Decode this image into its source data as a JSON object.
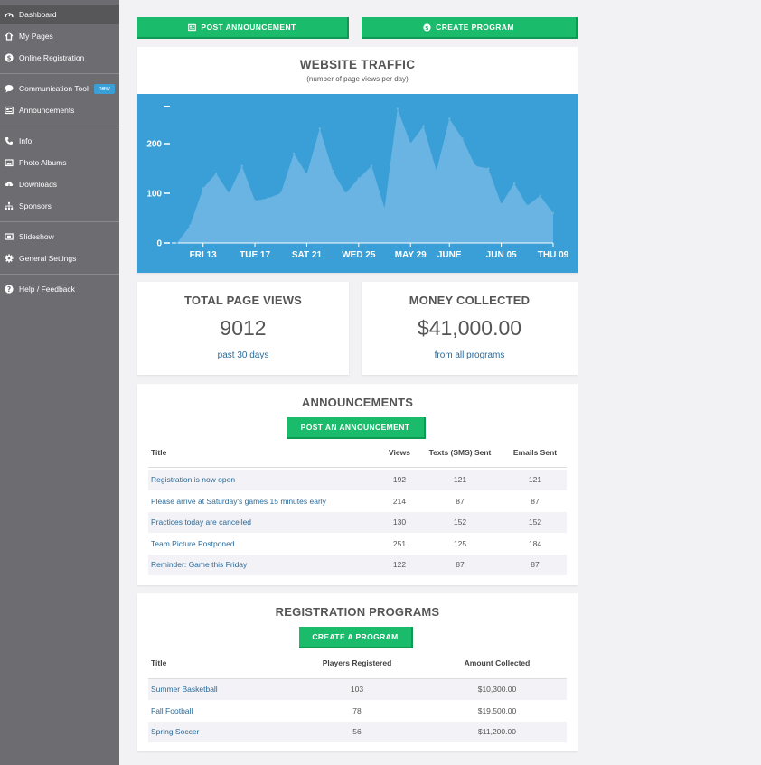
{
  "sidebar": {
    "items": [
      {
        "label": "Dashboard",
        "icon": "gauge-icon"
      },
      {
        "label": "My Pages",
        "icon": "home-icon"
      },
      {
        "label": "Online Registration",
        "icon": "dollar-icon"
      },
      {
        "label": "Communication Tool",
        "icon": "chat-icon",
        "badge": "new"
      },
      {
        "label": "Announcements",
        "icon": "newspaper-icon"
      },
      {
        "label": "Info",
        "icon": "phone-icon"
      },
      {
        "label": "Photo Albums",
        "icon": "photo-icon"
      },
      {
        "label": "Downloads",
        "icon": "cloud-download-icon"
      },
      {
        "label": "Sponsors",
        "icon": "sitemap-icon"
      },
      {
        "label": "Slideshow",
        "icon": "slideshow-icon"
      },
      {
        "label": "General Settings",
        "icon": "gear-icon"
      },
      {
        "label": "Help / Feedback",
        "icon": "question-icon"
      }
    ]
  },
  "top_buttons": {
    "post_announcement": "POST ANNOUNCEMENT",
    "create_program": "CREATE PROGRAM"
  },
  "traffic": {
    "title": "WEBSITE TRAFFIC",
    "subtitle": "(number of page views per day)"
  },
  "chart_data": {
    "type": "area",
    "title": "WEBSITE TRAFFIC",
    "subtitle": "(number of page views per day)",
    "ylim": [
      0,
      300
    ],
    "yticks": [
      {
        "v": 0,
        "label": "0"
      },
      {
        "v": 100,
        "label": "100"
      },
      {
        "v": 200,
        "label": "200"
      },
      {
        "v": 275,
        "label": ""
      }
    ],
    "xticks": [
      {
        "i": 2,
        "label": "FRI 13"
      },
      {
        "i": 6,
        "label": "TUE 17"
      },
      {
        "i": 10,
        "label": "SAT 21"
      },
      {
        "i": 14,
        "label": "WED 25"
      },
      {
        "i": 18,
        "label": "MAY 29"
      },
      {
        "i": 21,
        "label": "JUNE"
      },
      {
        "i": 25,
        "label": "JUN 05"
      },
      {
        "i": 29,
        "label": "THU 09"
      }
    ],
    "values": [
      0,
      35,
      110,
      140,
      100,
      155,
      85,
      90,
      100,
      180,
      138,
      230,
      145,
      100,
      130,
      155,
      70,
      270,
      200,
      235,
      145,
      250,
      210,
      155,
      150,
      78,
      120,
      75,
      95,
      60
    ],
    "fill_color": "#6ab4e3",
    "bg_color": "#3a9fd6",
    "grid": false
  },
  "stats": {
    "page_views": {
      "title": "TOTAL PAGE VIEWS",
      "value": "9012",
      "sub": "past 30 days"
    },
    "money": {
      "title": "MONEY COLLECTED",
      "value": "$41,000.00",
      "sub": "from all programs"
    }
  },
  "announcements": {
    "title": "ANNOUNCEMENTS",
    "button": "POST AN ANNOUNCEMENT",
    "headers": {
      "title": "Title",
      "views": "Views",
      "texts": "Texts (SMS) Sent",
      "emails": "Emails Sent"
    },
    "rows": [
      {
        "title": "Registration is now open",
        "views": "192",
        "texts": "121",
        "emails": "121"
      },
      {
        "title": "Please arrive at Saturday's games 15 minutes early",
        "views": "214",
        "texts": "87",
        "emails": "87"
      },
      {
        "title": "Practices today are cancelled",
        "views": "130",
        "texts": "152",
        "emails": "152"
      },
      {
        "title": "Team Picture Postponed",
        "views": "251",
        "texts": "125",
        "emails": "184"
      },
      {
        "title": "Reminder: Game this Friday",
        "views": "122",
        "texts": "87",
        "emails": "87"
      }
    ]
  },
  "programs": {
    "title": "REGISTRATION PROGRAMS",
    "button": "CREATE A PROGRAM",
    "headers": {
      "title": "Title",
      "players": "Players Registered",
      "amount": "Amount Collected"
    },
    "rows": [
      {
        "title": "Summer Basketball",
        "players": "103",
        "amount": "$10,300.00"
      },
      {
        "title": "Fall Football",
        "players": "78",
        "amount": "$19,500.00"
      },
      {
        "title": "Spring Soccer",
        "players": "56",
        "amount": "$11,200.00"
      }
    ]
  },
  "colors": {
    "accent_green": "#1abc6b",
    "chart_blue": "#3a9fd6",
    "sidebar": "#6d6c71",
    "link": "#2a6a99"
  }
}
